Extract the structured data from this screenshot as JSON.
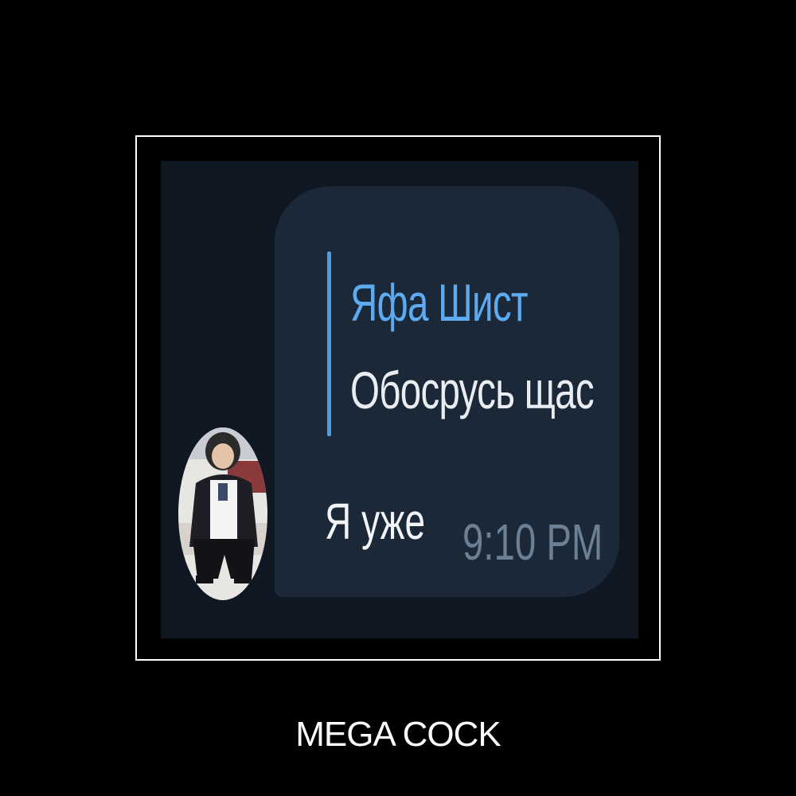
{
  "message": {
    "reply": {
      "author": "Яфа Шист",
      "text": "Обосрусь щас"
    },
    "text": "Я уже",
    "time": "9:10 PM"
  },
  "caption": "MEGA COCK",
  "colors": {
    "page_background": "#000000",
    "chat_background": "#0f1722",
    "bubble": "#1b2838",
    "reply_accent": "#4a9ee0",
    "reply_author": "#5eaaf0",
    "time": "#6b8094"
  }
}
